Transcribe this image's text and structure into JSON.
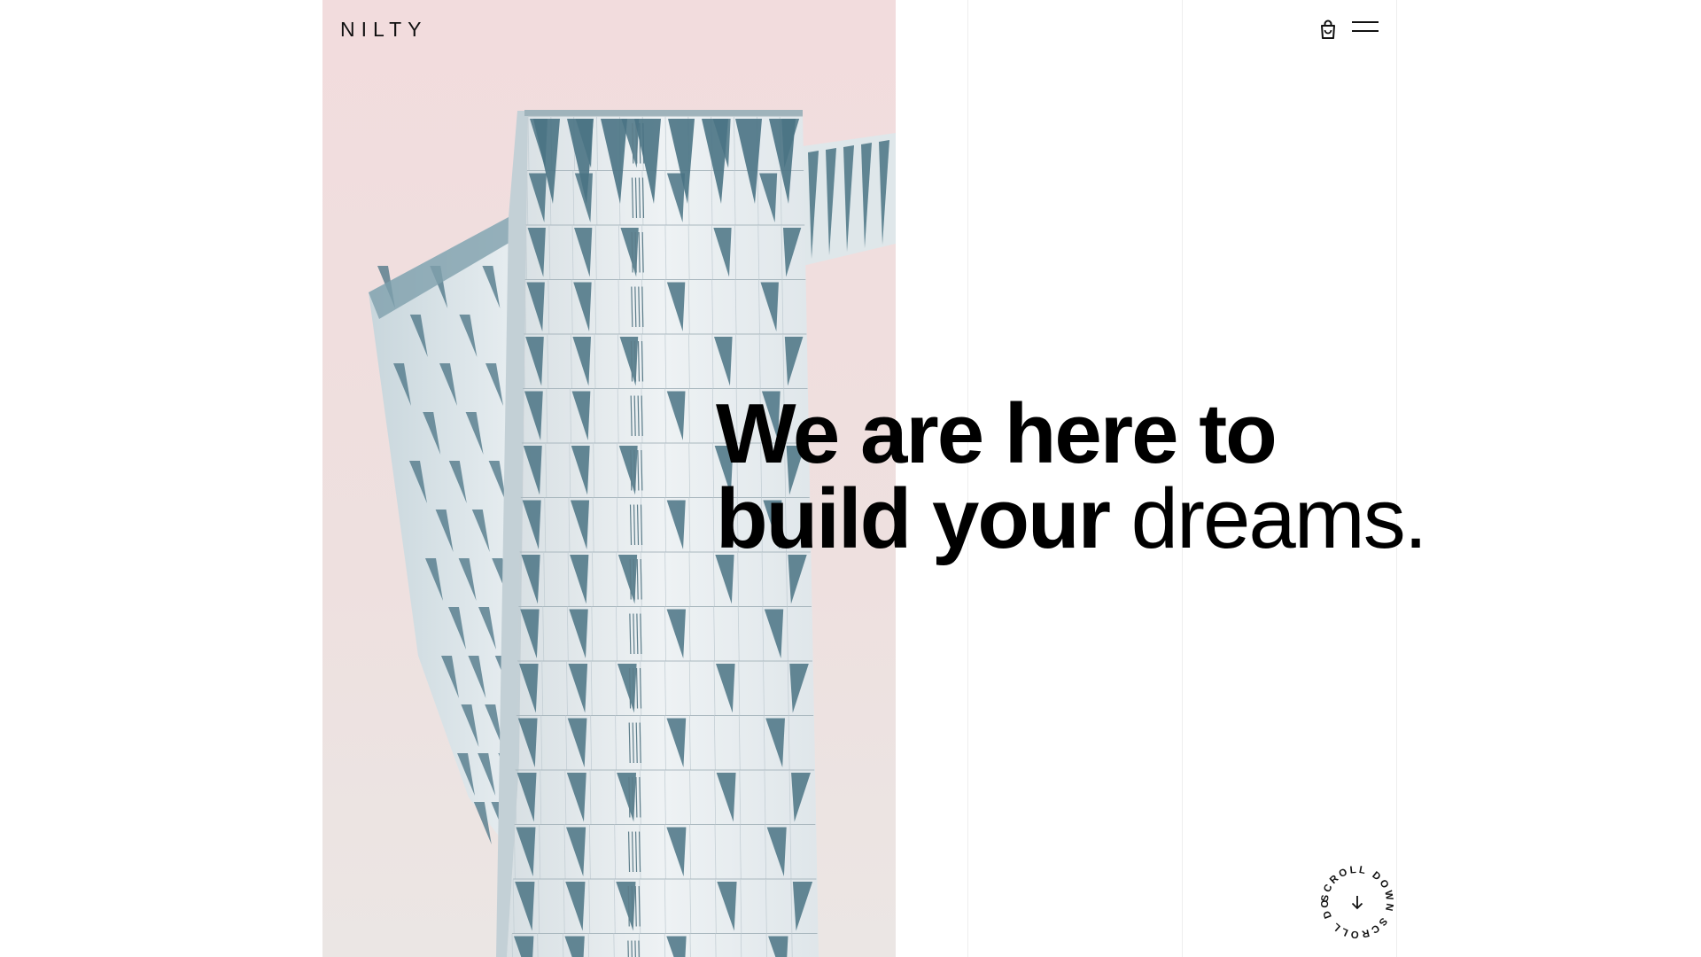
{
  "brand": {
    "logo_text": "NILTY"
  },
  "header": {
    "cart_icon": "shopping-bag-icon",
    "menu_icon": "hamburger-menu-icon"
  },
  "hero": {
    "headline_line1": "We are here to",
    "headline_line2_bold": "build your",
    "headline_line2_light": "dreams.",
    "image_subject": "glass-tower-building",
    "image_background_color": "#f2dede"
  },
  "scroll": {
    "label": "SCROLL DOWN SCROLL DOWN ",
    "icon": "arrow-down-icon"
  },
  "colors": {
    "text": "#000000",
    "background": "#ffffff",
    "gridline": "#eeeeee",
    "glass": "#4a7384",
    "facade": "#dfe6ea"
  }
}
